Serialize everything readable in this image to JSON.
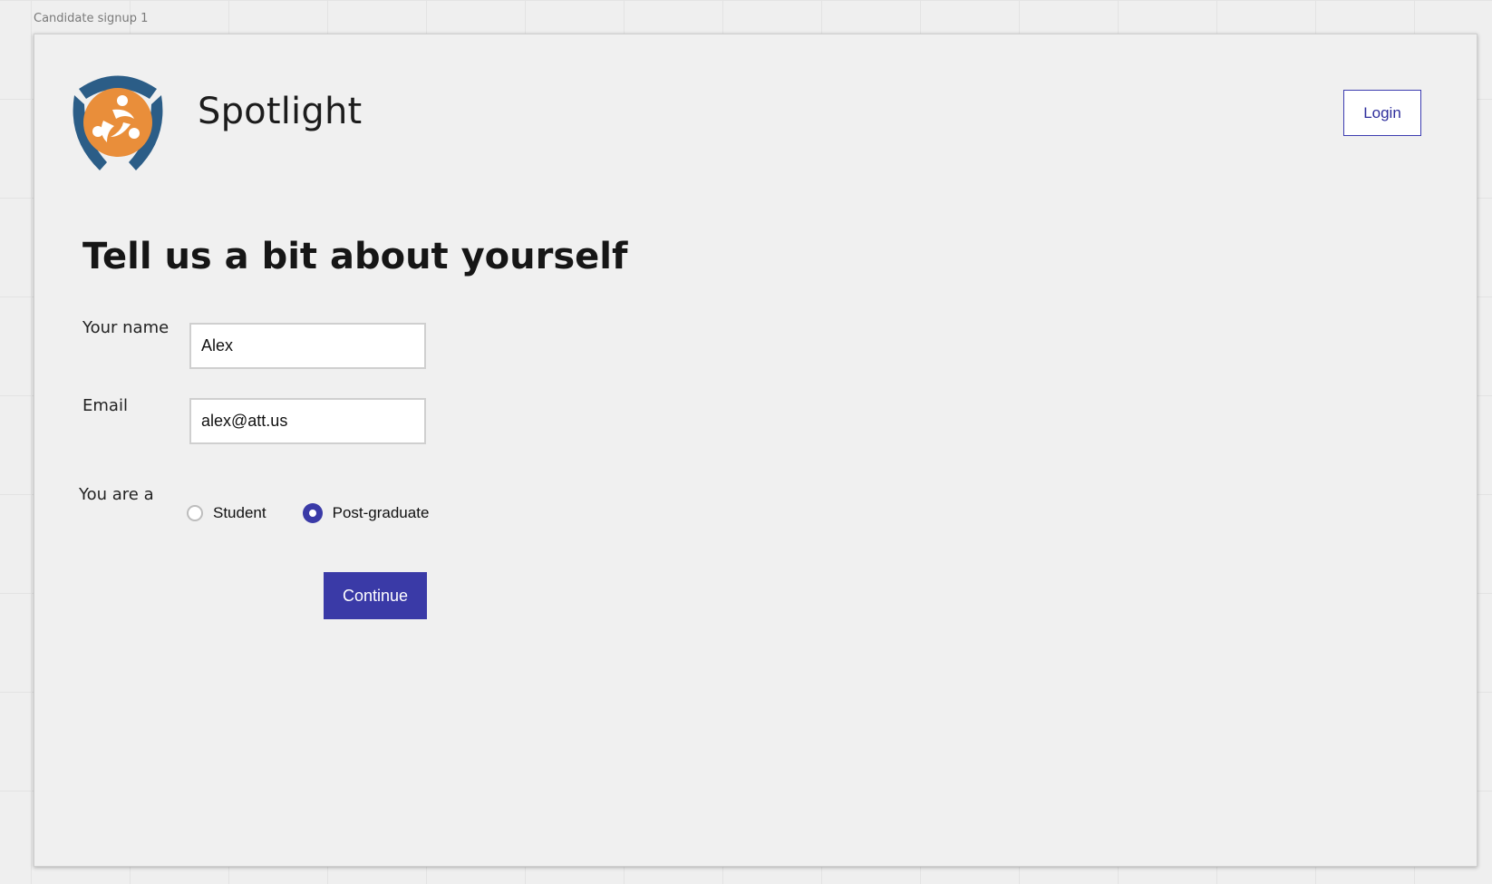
{
  "canvas": {
    "frame_label": "Candidate signup 1"
  },
  "header": {
    "brand": "Spotlight",
    "login_label": "Login",
    "logo_icon": "spotlight-logo-icon"
  },
  "form": {
    "heading": "Tell us a bit about yourself",
    "name": {
      "label": "Your name",
      "value": "Alex"
    },
    "email": {
      "label": "Email",
      "value": "alex@att.us"
    },
    "role": {
      "label": "You are a",
      "options": [
        {
          "label": "Student",
          "selected": false
        },
        {
          "label": "Post-graduate",
          "selected": true
        }
      ]
    },
    "continue_label": "Continue"
  },
  "colors": {
    "primary": "#3a3aa7",
    "logo_orange": "#e98e3a",
    "logo_blue": "#2b5d87",
    "background": "#f0f0f0"
  }
}
